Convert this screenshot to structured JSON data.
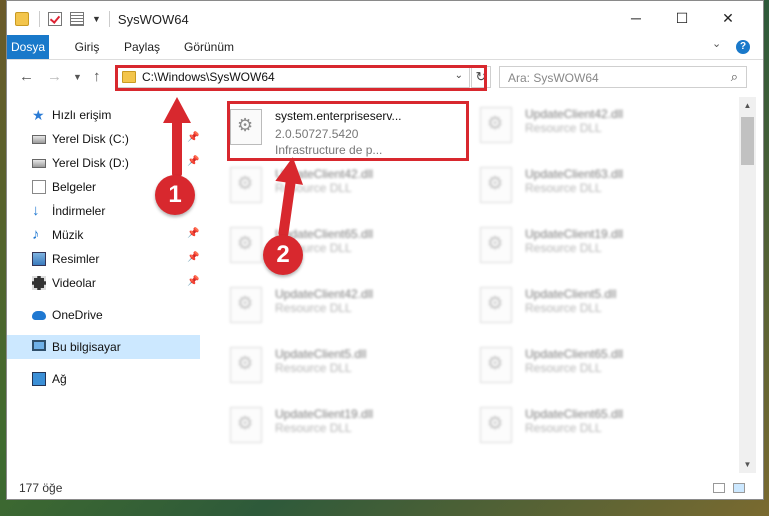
{
  "window": {
    "title": "SysWOW64"
  },
  "ribbon": {
    "tabs": [
      "Dosya",
      "Giriş",
      "Paylaş",
      "Görünüm"
    ]
  },
  "address": {
    "path": "C:\\Windows\\SysWOW64",
    "search_placeholder": "Ara: SysWOW64"
  },
  "sidebar": {
    "items": [
      {
        "label": "Hızlı erişim",
        "icon": "star-icon"
      },
      {
        "label": "Yerel Disk (C:)",
        "icon": "drive-icon"
      },
      {
        "label": "Yerel Disk (D:)",
        "icon": "drive-icon"
      },
      {
        "label": "Belgeler",
        "icon": "documents-icon"
      },
      {
        "label": "İndirmeler",
        "icon": "download-icon"
      },
      {
        "label": "Müzik",
        "icon": "music-icon"
      },
      {
        "label": "Resimler",
        "icon": "pictures-icon"
      },
      {
        "label": "Videolar",
        "icon": "videos-icon"
      },
      {
        "label": "OneDrive",
        "icon": "cloud-icon"
      },
      {
        "label": "Bu bilgisayar",
        "icon": "computer-icon"
      },
      {
        "label": "Ağ",
        "icon": "network-icon"
      }
    ]
  },
  "files": {
    "highlighted": {
      "name": "system.enterpriseserv...",
      "version": "2.0.50727.5420",
      "description": "Infrastructure de p..."
    },
    "left_column": [
      {
        "name": "UpdateClient42.dll",
        "type": "Resource DLL"
      },
      {
        "name": "UpdateClient65.dll",
        "type": "Resource DLL"
      },
      {
        "name": "UpdateClient42.dll",
        "type": "Resource DLL"
      },
      {
        "name": "UpdateClient5.dll",
        "type": "Resource DLL"
      },
      {
        "name": "UpdateClient19.dll",
        "type": "Resource DLL"
      }
    ],
    "right_column": [
      {
        "name": "UpdateClient42.dll",
        "type": "Resource DLL"
      },
      {
        "name": "UpdateClient63.dll",
        "type": "Resource DLL"
      },
      {
        "name": "UpdateClient19.dll",
        "type": "Resource DLL"
      },
      {
        "name": "UpdateClient5.dll",
        "type": "Resource DLL"
      },
      {
        "name": "UpdateClient65.dll",
        "type": "Resource DLL"
      },
      {
        "name": "UpdateClient65.dll",
        "type": "Resource DLL"
      }
    ]
  },
  "status": {
    "count": "177 öğe"
  },
  "annotations": {
    "badge1": "1",
    "badge2": "2"
  },
  "colors": {
    "accent": "#1979ca",
    "annotation": "#d8282e",
    "selection": "#cce8ff"
  }
}
